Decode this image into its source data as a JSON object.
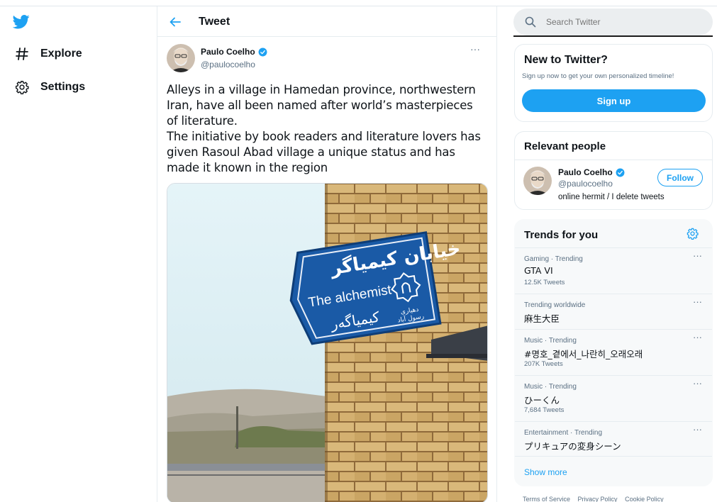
{
  "nav": {
    "explore_label": "Explore",
    "settings_label": "Settings",
    "logo_icon": "twitter-bird-icon",
    "accent": "#1da1f2"
  },
  "header": {
    "title": "Tweet"
  },
  "tweet": {
    "author_name": "Paulo Coelho",
    "author_handle": "@paulocoelho",
    "more": "···",
    "text_lines": [
      "Alleys in a village in Hamedan province, northwestern Iran, have all been named after world’s masterpieces of literature.",
      "The initiative by book readers and literature lovers has given Rasoul Abad village a unique status and has made it known in the region"
    ],
    "media": {
      "sign_persian_top": "خیابان کیمیاگر",
      "sign_english": "The alchemist",
      "sign_kurdish": "کیمیاگەر",
      "sign_small_1": "دهیاری",
      "sign_small_2": "رسول آباد"
    }
  },
  "search": {
    "placeholder": "Search Twitter"
  },
  "new_to_twitter": {
    "title": "New to Twitter?",
    "subtitle": "Sign up now to get your own personalized timeline!",
    "signup_label": "Sign up"
  },
  "relevant_people": {
    "title": "Relevant people",
    "name": "Paulo Coelho",
    "handle": "@paulocoelho",
    "bio": "online hermit / I delete tweets",
    "follow_label": "Follow"
  },
  "trends": {
    "title": "Trends for you",
    "items": [
      {
        "meta": "Gaming · Trending",
        "name": "GTA VI",
        "count": "12.5K Tweets"
      },
      {
        "meta": "Trending worldwide",
        "name": "麻生大臣",
        "count": ""
      },
      {
        "meta": "Music · Trending",
        "name": "#명호_곁에서_나란히_오래오래",
        "count": "207K Tweets"
      },
      {
        "meta": "Music · Trending",
        "name": "ひーくん",
        "count": "7,684 Tweets"
      },
      {
        "meta": "Entertainment · Trending",
        "name": "プリキュアの変身シーン",
        "count": ""
      }
    ],
    "more": "···",
    "show_more": "Show more"
  },
  "footer": {
    "links": [
      "Terms of Service",
      "Privacy Policy",
      "Cookie Policy"
    ]
  }
}
